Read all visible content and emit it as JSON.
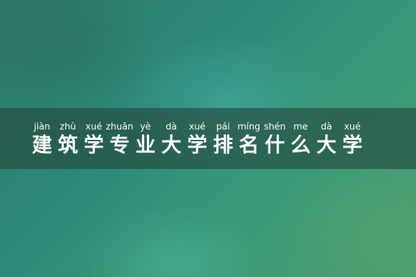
{
  "title": {
    "chars": [
      {
        "pinyin": "jiàn",
        "hanzi": "建"
      },
      {
        "pinyin": "zhù",
        "hanzi": "筑"
      },
      {
        "pinyin": "xué",
        "hanzi": "学"
      },
      {
        "pinyin": "zhuān",
        "hanzi": "专"
      },
      {
        "pinyin": "yè",
        "hanzi": "业"
      },
      {
        "pinyin": "dà",
        "hanzi": "大"
      },
      {
        "pinyin": "xué",
        "hanzi": "学"
      },
      {
        "pinyin": "pái",
        "hanzi": "排"
      },
      {
        "pinyin": "míng",
        "hanzi": "名"
      },
      {
        "pinyin": "shén",
        "hanzi": "什"
      },
      {
        "pinyin": "me",
        "hanzi": "么"
      },
      {
        "pinyin": "dà",
        "hanzi": "大"
      },
      {
        "pinyin": "xué",
        "hanzi": "学"
      }
    ]
  },
  "colors": {
    "text": "#ffffff",
    "band": "#23463c"
  }
}
